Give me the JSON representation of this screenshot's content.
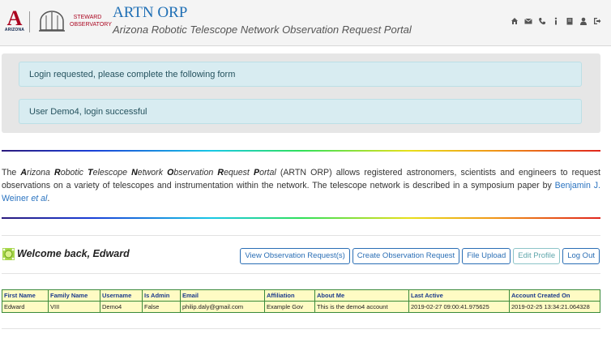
{
  "header": {
    "ua_letter": "A",
    "ua_word": "ARIZONA",
    "observatory_line1": "STEWARD",
    "observatory_line2": "OBSERVATORY",
    "title": "ARTN ORP",
    "subtitle": "Arizona Robotic Telescope Network Observation Request Portal",
    "icons": [
      "home-icon",
      "envelope-icon",
      "phone-icon",
      "info-icon",
      "book-icon",
      "user-icon",
      "sign-out-icon"
    ]
  },
  "alerts": [
    "Login requested, please complete the following form",
    "User Demo4, login successful"
  ],
  "intro": {
    "prefix": "The ",
    "name_parts": [
      {
        "bold": "A",
        "rest": "rizona "
      },
      {
        "bold": "R",
        "rest": "obotic "
      },
      {
        "bold": "T",
        "rest": "elescope "
      },
      {
        "bold": "N",
        "rest": "etwork "
      },
      {
        "bold": "O",
        "rest": "bservation "
      },
      {
        "bold": "R",
        "rest": "equest "
      },
      {
        "bold": "P",
        "rest": "ortal"
      }
    ],
    "body": " (ARTN ORP) allows registered astronomers, scientists and engineers to request observations on a variety of telescopes and instrumentation within the network. The telescope network is described in a symposium paper by ",
    "link_text": "Benjamin J. Weiner",
    "link_suffix": " et al",
    "end": "."
  },
  "welcome": "Welcome back, Edward",
  "buttons": {
    "view": "View Observation Request(s)",
    "create": "Create Observation Request",
    "upload": "File Upload",
    "edit": "Edit Profile",
    "logout": "Log Out"
  },
  "table": {
    "headers": [
      "First Name",
      "Family Name",
      "Username",
      "Is Admin",
      "Email",
      "Affiliation",
      "About Me",
      "Last Active",
      "Account Created On"
    ],
    "rows": [
      [
        "Edward",
        "VIII",
        "Demo4",
        "False",
        "philip.daly@gmail.com",
        "Example Gov",
        "This is the demo4 account",
        "2019-02-27 09:00:41.975625",
        "2019-02-25 13:34:21.064328"
      ]
    ]
  },
  "colors": {
    "ua_red": "#ab0520",
    "title_blue": "#1f6fb5",
    "alert_bg": "#d8ecf1",
    "table_bg": "#fffbc4",
    "table_border": "#3a8a3a"
  }
}
